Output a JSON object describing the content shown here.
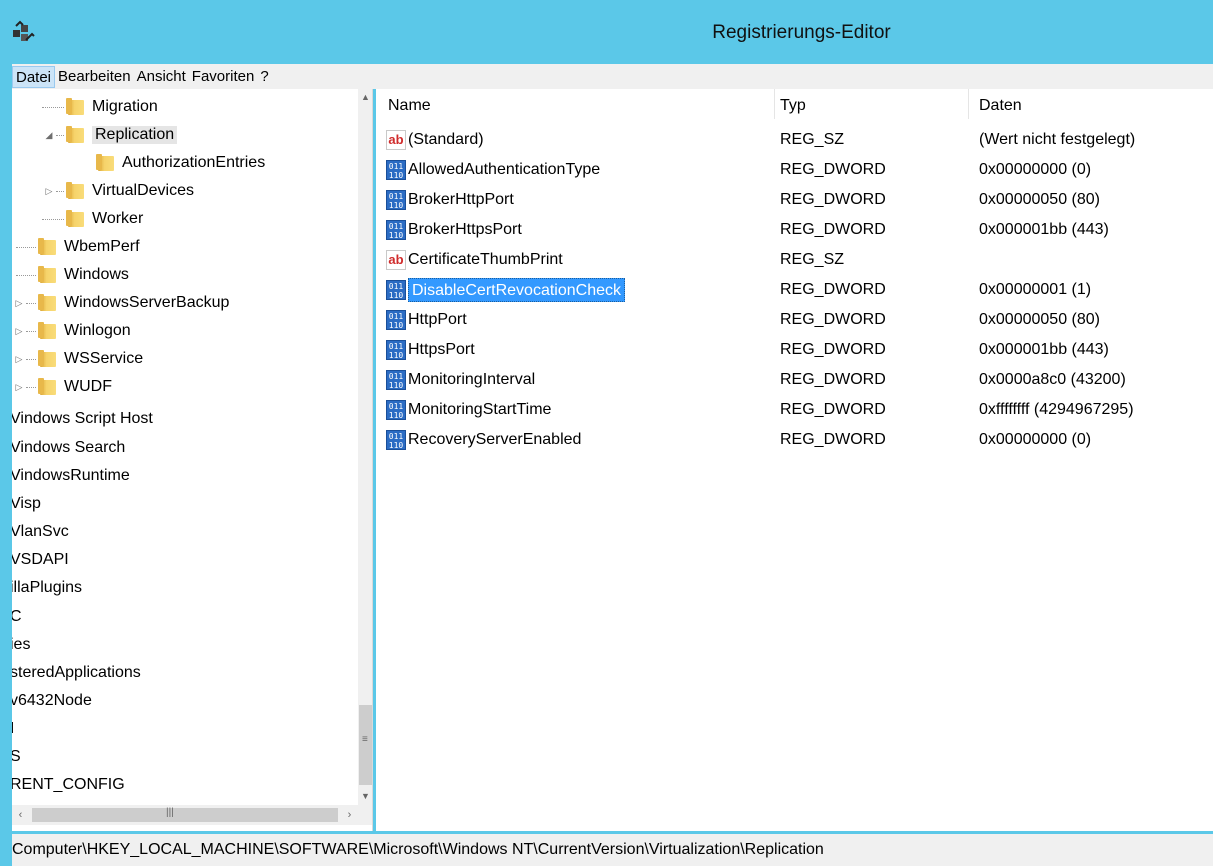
{
  "window": {
    "title": "Registrierungs-Editor"
  },
  "menu": [
    "Datei",
    "Bearbeiten",
    "Ansicht",
    "Favoriten",
    "?"
  ],
  "tree": [
    {
      "label": "Migration",
      "expander": ""
    },
    {
      "label": "Replication",
      "expander": "◢",
      "selected": true
    },
    {
      "label": "AuthorizationEntries",
      "expander": ""
    },
    {
      "label": "VirtualDevices",
      "expander": "▷"
    },
    {
      "label": "Worker",
      "expander": ""
    },
    {
      "label": "WbemPerf",
      "expander": ""
    },
    {
      "label": "Windows",
      "expander": ""
    },
    {
      "label": "WindowsServerBackup",
      "expander": "▷"
    },
    {
      "label": "Winlogon",
      "expander": "▷"
    },
    {
      "label": "WSService",
      "expander": "▷"
    },
    {
      "label": "WUDF",
      "expander": "▷"
    },
    {
      "label": "Vindows Script Host"
    },
    {
      "label": "Vindows Search"
    },
    {
      "label": "VindowsRuntime"
    },
    {
      "label": "Visp"
    },
    {
      "label": "VlanSvc"
    },
    {
      "label": "VSDAPI"
    },
    {
      "label": "illaPlugins"
    },
    {
      "label": "C"
    },
    {
      "label": "ies"
    },
    {
      "label": "steredApplications"
    },
    {
      "label": "v6432Node"
    },
    {
      "label": "I"
    },
    {
      "label": "S"
    },
    {
      "label": "RENT_CONFIG"
    }
  ],
  "columns": {
    "name": "Name",
    "type": "Typ",
    "data": "Daten"
  },
  "values": [
    {
      "icon": "string-value-icon",
      "name": "(Standard)",
      "type": "REG_SZ",
      "data": "(Wert nicht festgelegt)"
    },
    {
      "icon": "binary-value-icon",
      "name": "AllowedAuthenticationType",
      "type": "REG_DWORD",
      "data": "0x00000000 (0)"
    },
    {
      "icon": "binary-value-icon",
      "name": "BrokerHttpPort",
      "type": "REG_DWORD",
      "data": "0x00000050 (80)"
    },
    {
      "icon": "binary-value-icon",
      "name": "BrokerHttpsPort",
      "type": "REG_DWORD",
      "data": "0x000001bb (443)"
    },
    {
      "icon": "string-value-icon",
      "name": "CertificateThumbPrint",
      "type": "REG_SZ",
      "data": ""
    },
    {
      "icon": "binary-value-icon",
      "name": "DisableCertRevocationCheck",
      "type": "REG_DWORD",
      "data": "0x00000001 (1)",
      "selected": true
    },
    {
      "icon": "binary-value-icon",
      "name": "HttpPort",
      "type": "REG_DWORD",
      "data": "0x00000050 (80)"
    },
    {
      "icon": "binary-value-icon",
      "name": "HttpsPort",
      "type": "REG_DWORD",
      "data": "0x000001bb (443)"
    },
    {
      "icon": "binary-value-icon",
      "name": "MonitoringInterval",
      "type": "REG_DWORD",
      "data": "0x0000a8c0 (43200)"
    },
    {
      "icon": "binary-value-icon",
      "name": "MonitoringStartTime",
      "type": "REG_DWORD",
      "data": "0xffffffff (4294967295)"
    },
    {
      "icon": "binary-value-icon",
      "name": "RecoveryServerEnabled",
      "type": "REG_DWORD",
      "data": "0x00000000 (0)"
    }
  ],
  "status": {
    "path": "Computer\\HKEY_LOCAL_MACHINE\\SOFTWARE\\Microsoft\\Windows NT\\CurrentVersion\\Virtualization\\Replication"
  },
  "colors": {
    "titlebar": "#5bc8e8",
    "selection": "#3399ff"
  }
}
